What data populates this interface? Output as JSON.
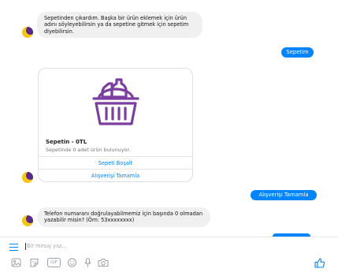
{
  "messages": {
    "bot1": "Sepetinden çıkardım. Başka bir ürün eklemek için ürün adını söyleyebilirsin ya da sepetine gitmek için sepetim diyebilirsin.",
    "user1": "Sepetim",
    "user2": "Alışverişi Tamamla",
    "bot2": "Telefon numaranı doğrulayabilmemiz için başında 0 olmadan yazabilir misin? (Örn: 53xxxxxxxx)"
  },
  "card": {
    "title": "Sepetin - 0TL",
    "subtitle": "Sepetinde 0 adet ürün bulunuyor.",
    "button_empty": "Sepeti Boşalt",
    "button_checkout": "Alışverişi Tamamla"
  },
  "composer": {
    "placeholder": "Bir mesaj yaz...",
    "gif_label": "GIF"
  },
  "colors": {
    "accent": "#0084ff",
    "bubble": "#f1f0f0",
    "basket": "#7b3fa0"
  },
  "icons": [
    "menu-icon",
    "image-icon",
    "sticker-icon",
    "gif-icon",
    "emoji-icon",
    "microphone-icon",
    "camera-icon",
    "thumbs-up-icon",
    "basket-icon"
  ]
}
